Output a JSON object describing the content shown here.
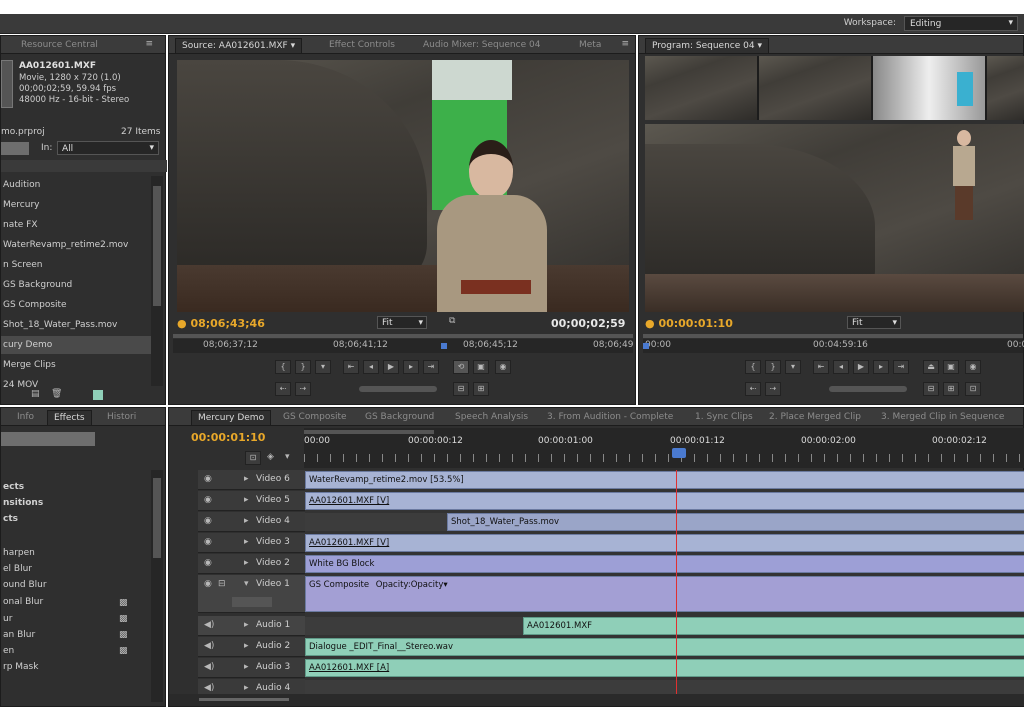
{
  "workspace": {
    "label": "Workspace:",
    "value": "Editing"
  },
  "project_panel": {
    "tabs": [
      "Resource Central"
    ],
    "clip_name": "AA012601.MXF",
    "clip_info": [
      "Movie, 1280 x 720 (1.0)",
      "00;00;02;59, 59.94 fps",
      "48000 Hz - 16-bit - Stereo"
    ],
    "project_file": "mo.prproj",
    "items_count": "27 Items",
    "in_label": "In:",
    "in_value": "All",
    "items": [
      "Audition",
      "Mercury",
      "nate FX",
      "WaterRevamp_retime2.mov",
      "n Screen",
      "GS Background",
      "GS Composite",
      "Shot_18_Water_Pass.mov",
      "cury Demo",
      "Merge Clips",
      "24 MOV"
    ]
  },
  "source_monitor": {
    "tabs": [
      "Source: AA012601.MXF",
      "Effect Controls",
      "Audio Mixer: Sequence 04",
      "Meta"
    ],
    "timecode_in": "08;06;43;46",
    "fit": "Fit",
    "duration": "00;00;02;59",
    "ruler": [
      "08;06;37;12",
      "08;06;41;12",
      "08;06;45;12",
      "08;06;49"
    ]
  },
  "program_monitor": {
    "tabs": [
      "Program: Sequence 04"
    ],
    "timecode": "00:00:01:10",
    "fit": "Fit",
    "ruler": [
      "00:00",
      "00:04:59:16",
      "00:0"
    ]
  },
  "effects_panel": {
    "tabs": [
      "Info",
      "Effects",
      "Histori"
    ],
    "items": [
      "ects",
      "nsitions",
      "cts",
      "harpen",
      "el Blur",
      "ound Blur",
      "onal Blur",
      "ur",
      "an Blur",
      "en",
      "rp Mask"
    ]
  },
  "timeline": {
    "tabs": [
      "Mercury Demo",
      "GS Composite",
      "GS Background",
      "Speech Analysis",
      "3. From Audition - Complete",
      "1. Sync Clips",
      "2. Place Merged Clip",
      "3. Merged Clip in Sequence"
    ],
    "timecode": "00:00:01:10",
    "ruler": [
      "00:00",
      "00:00:00:12",
      "00:00:01:00",
      "00:00:01:12",
      "00:00:02:00",
      "00:00:02:12"
    ],
    "tracks": [
      {
        "name": "Video 6",
        "clips": [
          {
            "label": "WaterRevamp_retime2.mov [53.5%]"
          }
        ]
      },
      {
        "name": "Video 5",
        "clips": [
          {
            "label": "AA012601.MXF [V]"
          }
        ]
      },
      {
        "name": "Video 4",
        "clips": [
          {
            "label": "Shot_18_Water_Pass.mov"
          }
        ]
      },
      {
        "name": "Video 3",
        "clips": [
          {
            "label": "AA012601.MXF [V]"
          }
        ]
      },
      {
        "name": "Video 2",
        "clips": [
          {
            "label": "White BG Block"
          }
        ]
      },
      {
        "name": "Video 1",
        "clips": [
          {
            "label": "GS Composite",
            "extra": "Opacity:Opacity"
          }
        ]
      },
      {
        "name": "Audio 1",
        "clips": [
          {
            "label": "AA012601.MXF"
          }
        ]
      },
      {
        "name": "Audio 2",
        "clips": [
          {
            "label": "Dialogue _EDIT_Final__Stereo.wav"
          }
        ]
      },
      {
        "name": "Audio 3",
        "clips": [
          {
            "label": "AA012601.MXF [A]"
          }
        ]
      },
      {
        "name": "Audio 4",
        "clips": []
      }
    ]
  },
  "colors": {
    "timecode": "#e8a82a",
    "video_clip": "#a7b3d4",
    "audio_clip": "#8fcfb8",
    "playhead": "#e03030"
  }
}
